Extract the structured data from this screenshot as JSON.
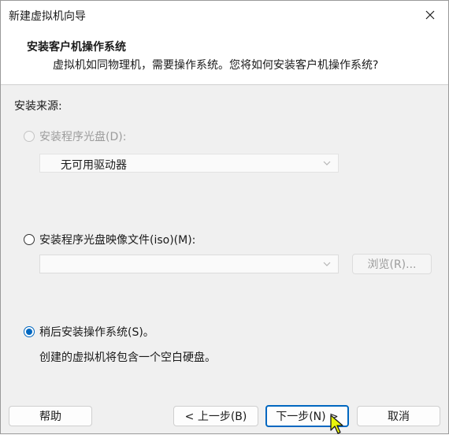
{
  "window": {
    "title": "新建虚拟机向导"
  },
  "header": {
    "title": "安装客户机操作系统",
    "subtitle": "虚拟机如同物理机，需要操作系统。您将如何安装客户机操作系统?"
  },
  "source": {
    "label": "安装来源:",
    "option_disc": {
      "label": "安装程序光盘(D):",
      "selected": false,
      "enabled": false
    },
    "disc_drive": {
      "value": "无可用驱动器"
    },
    "option_iso": {
      "label": "安装程序光盘映像文件(iso)(M):",
      "selected": false,
      "enabled": true
    },
    "iso_path": {
      "value": ""
    },
    "browse_button": "浏览(R)...",
    "option_later": {
      "label": "稍后安装操作系统(S)。",
      "selected": true,
      "enabled": true
    },
    "later_note": "创建的虚拟机将包含一个空白硬盘。"
  },
  "footer": {
    "help": "帮助",
    "back": "< 上一步(B)",
    "next": "下一步(N) >",
    "cancel": "取消"
  },
  "colors": {
    "accent": "#0067c0",
    "cursor": "#e8f40a"
  }
}
